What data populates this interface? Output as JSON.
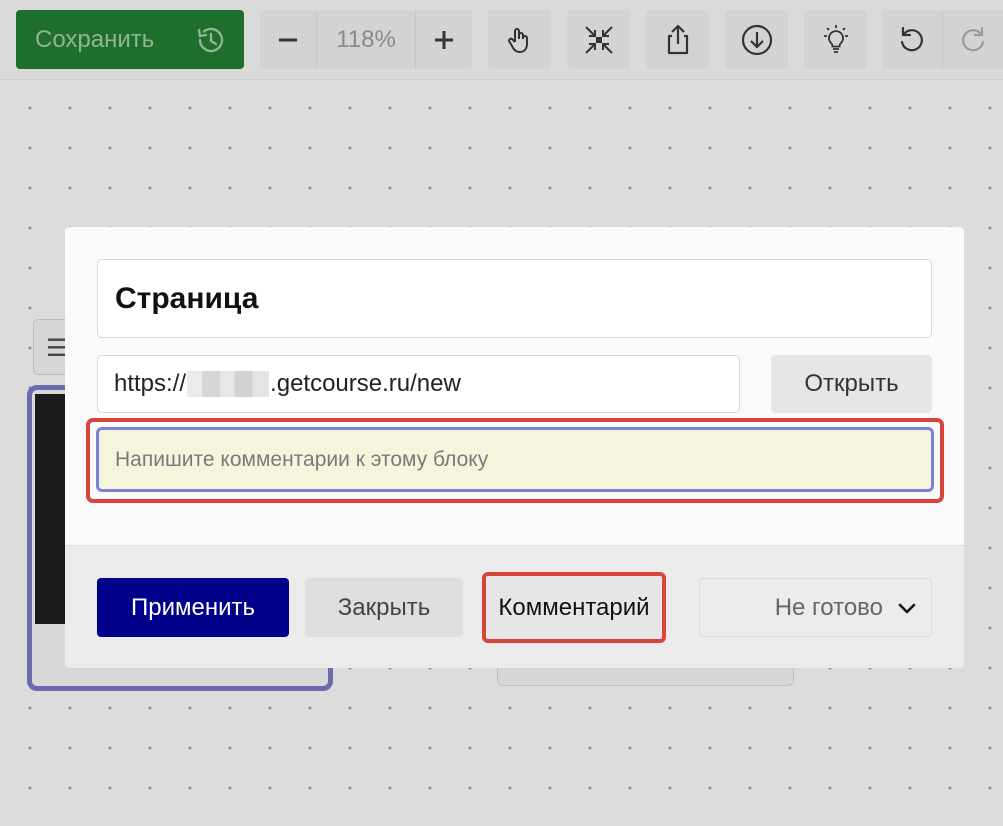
{
  "toolbar": {
    "save_label": "Сохранить",
    "zoom_value": "118%",
    "icons": [
      "history-icon",
      "minus-icon",
      "plus-icon",
      "hand-icon",
      "collapse-icon",
      "share-icon",
      "download-icon",
      "lightbulb-icon",
      "undo-icon",
      "redo-icon"
    ]
  },
  "canvas": {
    "chip_glyph": "☰"
  },
  "modal": {
    "title_value": "Страница",
    "url_prefix": "https://",
    "url_suffix": ".getcourse.ru/new",
    "open_label": "Открыть",
    "comment_placeholder": "Напишите комментарии к этому блоку",
    "apply_label": "Применить",
    "close_label": "Закрыть",
    "comment_label": "Комментарий",
    "status_value": "Не готово"
  },
  "colors": {
    "save": "#1e6e2c",
    "apply": "#01008a",
    "highlight": "#d8443c",
    "comment_bg": "#f5f5dc",
    "focus_border": "#7b80d8"
  }
}
